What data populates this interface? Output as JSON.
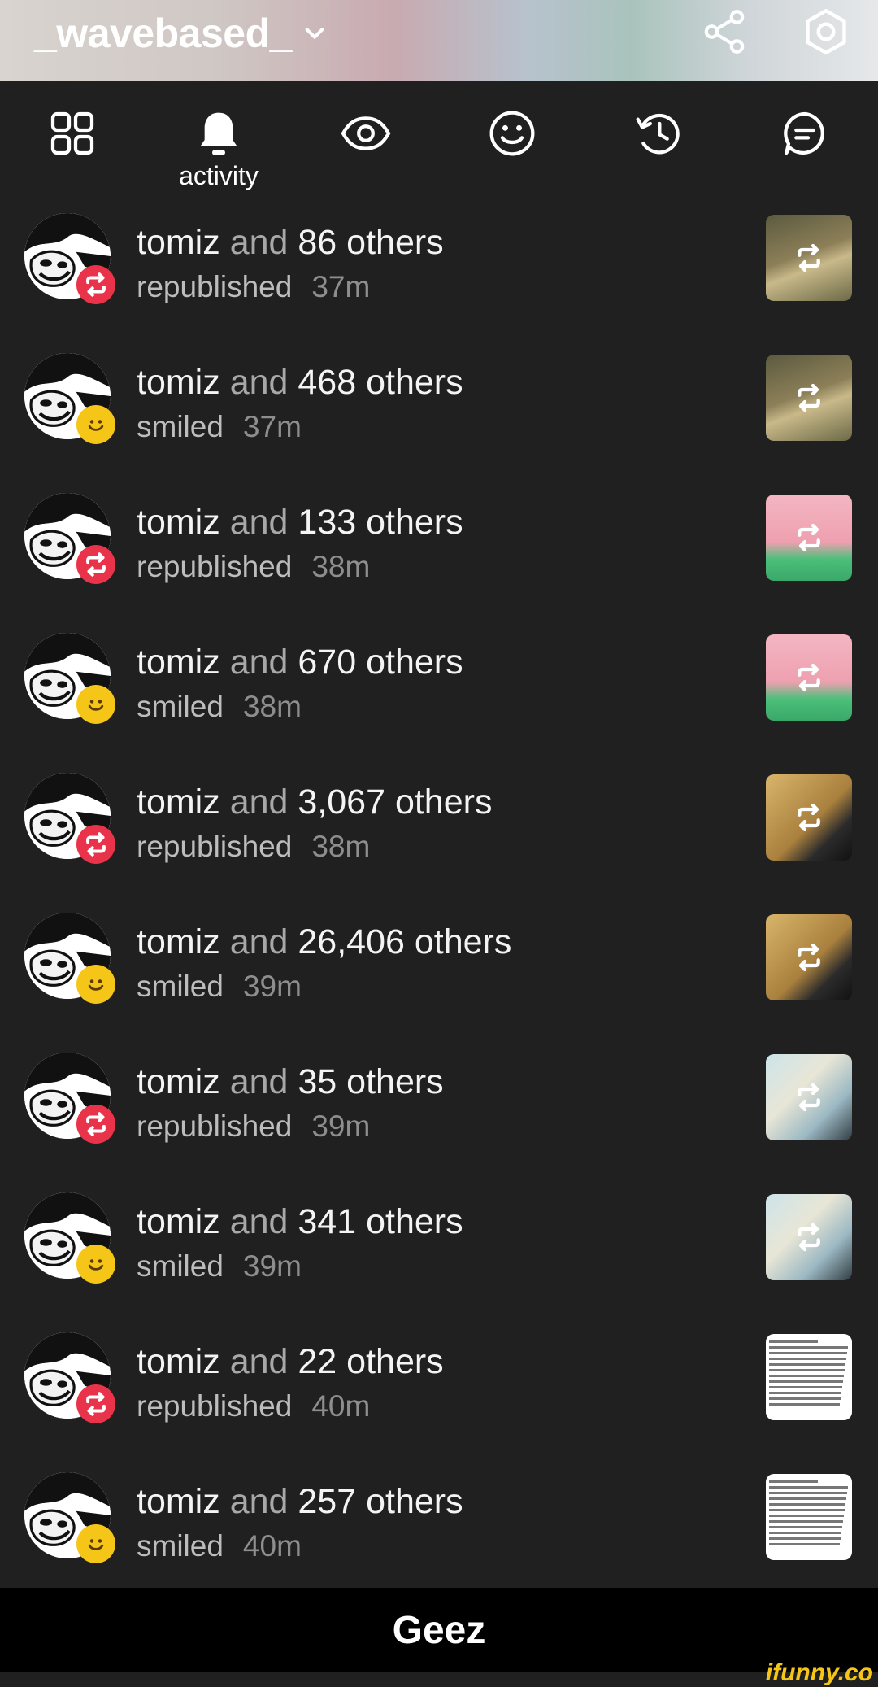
{
  "header": {
    "username": "_wavebased_",
    "icons": [
      "chevron-down-icon",
      "share-icon",
      "settings-icon"
    ]
  },
  "tabs": [
    {
      "name": "grid-icon"
    },
    {
      "name": "bell-icon",
      "label": "activity",
      "active": true
    },
    {
      "name": "eye-icon"
    },
    {
      "name": "smile-icon"
    },
    {
      "name": "history-icon"
    },
    {
      "name": "chat-icon"
    }
  ],
  "activity": [
    {
      "name": "tomiz",
      "and": "and",
      "count": "86 others",
      "action": "republished",
      "time": "37m",
      "type": "republish",
      "thumb": "lion"
    },
    {
      "name": "tomiz",
      "and": "and",
      "count": "468 others",
      "action": "smiled",
      "time": "37m",
      "type": "smile",
      "thumb": "lion"
    },
    {
      "name": "tomiz",
      "and": "and",
      "count": "133 others",
      "action": "republished",
      "time": "38m",
      "type": "republish",
      "thumb": "pat"
    },
    {
      "name": "tomiz",
      "and": "and",
      "count": "670 others",
      "action": "smiled",
      "time": "38m",
      "type": "smile",
      "thumb": "pat"
    },
    {
      "name": "tomiz",
      "and": "and",
      "count": "3,067 others",
      "action": "republished",
      "time": "38m",
      "type": "republish",
      "thumb": "cat"
    },
    {
      "name": "tomiz",
      "and": "and",
      "count": "26,406 others",
      "action": "smiled",
      "time": "39m",
      "type": "smile",
      "thumb": "cat"
    },
    {
      "name": "tomiz",
      "and": "and",
      "count": "35 others",
      "action": "republished",
      "time": "39m",
      "type": "republish",
      "thumb": "comic"
    },
    {
      "name": "tomiz",
      "and": "and",
      "count": "341 others",
      "action": "smiled",
      "time": "39m",
      "type": "smile",
      "thumb": "comic"
    },
    {
      "name": "tomiz",
      "and": "and",
      "count": "22 others",
      "action": "republished",
      "time": "40m",
      "type": "republish",
      "thumb": "doc"
    },
    {
      "name": "tomiz",
      "and": "and",
      "count": "257 others",
      "action": "smiled",
      "time": "40m",
      "type": "smile",
      "thumb": "doc"
    }
  ],
  "footer": {
    "caption": "Geez"
  },
  "watermark": "ifunny.co",
  "colors": {
    "background": "#202020",
    "republish_badge": "#e8334a",
    "smile_badge": "#f5c518"
  }
}
